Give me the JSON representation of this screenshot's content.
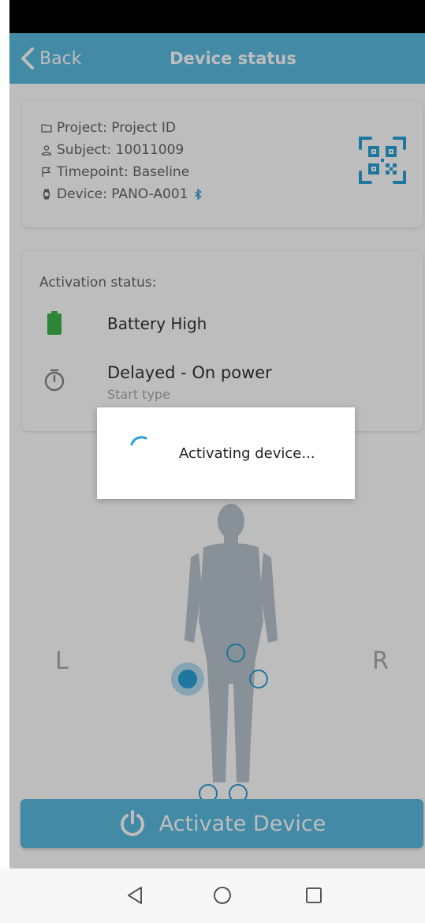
{
  "header": {
    "back_label": "Back",
    "title": "Device status"
  },
  "info": {
    "project": "Project: Project ID",
    "subject": "Subject: 10011009",
    "timepoint": "Timepoint: Baseline",
    "device": "Device: PANO-A001"
  },
  "activation": {
    "title": "Activation status:",
    "battery": "Battery High",
    "start_value": "Delayed -  On power",
    "start_label": "Start type"
  },
  "body_map": {
    "left_label": "L",
    "right_label": "R"
  },
  "action": {
    "activate_label": "Activate Device"
  },
  "dialog": {
    "text": "Activating device..."
  },
  "colors": {
    "accent": "#5bbbe0",
    "sensor": "#2a9fd6",
    "bluetooth": "#2a9fd6",
    "battery": "#3cb54a"
  },
  "icons": {
    "back": "chevron-left-icon",
    "project": "folder-icon",
    "subject": "person-icon",
    "timepoint": "flag-icon",
    "device": "watch-icon",
    "bluetooth": "bluetooth-icon",
    "qr": "qr-code-icon",
    "battery": "battery-icon",
    "timer": "timer-icon",
    "power": "power-icon",
    "spinner": "spinner-icon"
  }
}
